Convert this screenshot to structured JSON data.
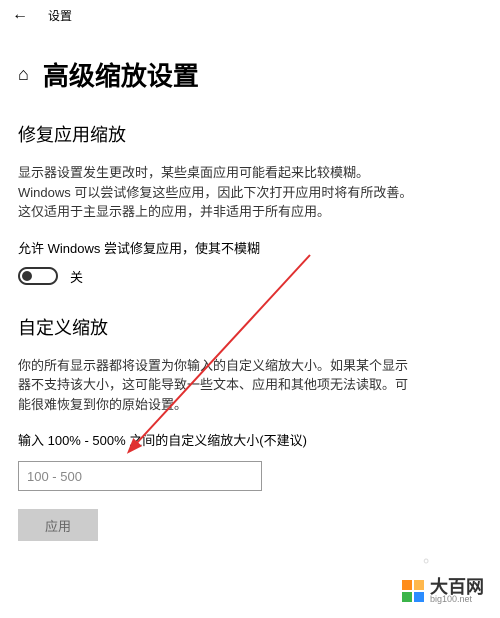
{
  "topbar": {
    "title": "设置"
  },
  "page": {
    "title": "高级缩放设置"
  },
  "section1": {
    "title": "修复应用缩放",
    "desc": "显示器设置发生更改时，某些桌面应用可能看起来比较模糊。Windows 可以尝试修复这些应用，因此下次打开应用时将有所改善。这仅适用于主显示器上的应用，并非适用于所有应用。",
    "toggle_label": "允许 Windows 尝试修复应用，使其不模糊",
    "toggle_state": "关"
  },
  "section2": {
    "title": "自定义缩放",
    "desc": "你的所有显示器都将设置为你输入的自定义缩放大小。如果某个显示器不支持该大小，这可能导致一些文本、应用和其他项无法读取。可能很难恢复到你的原始设置。",
    "input_label": "输入 100% - 500% 之间的自定义缩放大小(不建议)",
    "input_placeholder": "100 - 500",
    "apply_label": "应用"
  },
  "watermark": {
    "brand": "大百网",
    "sub": "big100.net"
  }
}
